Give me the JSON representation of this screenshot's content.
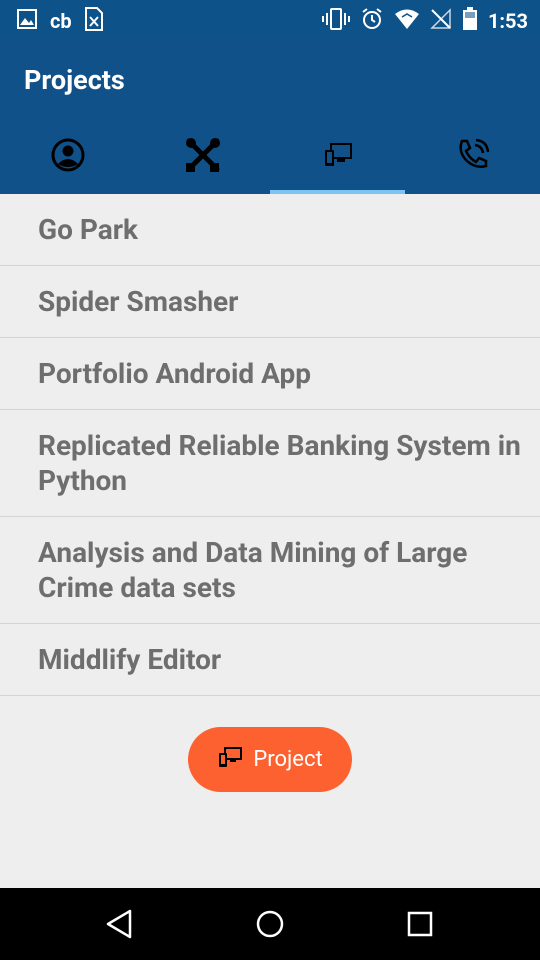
{
  "status_bar": {
    "carrier_label": "cb",
    "time": "1:53",
    "left_icons": [
      "gallery-icon",
      "cb-icon",
      "sim-card-icon"
    ],
    "right_icons": [
      "vibrate-icon",
      "alarm-icon",
      "wifi-icon",
      "no-signal-icon",
      "battery-icon"
    ]
  },
  "app_bar": {
    "title": "Projects",
    "tabs": [
      {
        "icon": "account-circle-icon",
        "active": false
      },
      {
        "icon": "tools-icon",
        "active": false
      },
      {
        "icon": "devices-icon",
        "active": true
      },
      {
        "icon": "phone-ringing-icon",
        "active": false
      }
    ]
  },
  "projects": [
    "Go Park",
    "Spider Smasher",
    "Portfolio Android App",
    "Replicated Reliable Banking System in Python",
    "Analysis and Data Mining of Large Crime data sets",
    "Middlify Editor"
  ],
  "fab": {
    "label": "Project",
    "icon": "devices-icon"
  },
  "colors": {
    "primary": "#115189",
    "status": "#0d5288",
    "accent": "#fe6130",
    "indicator": "#7cc4f2"
  },
  "nav_bar": {
    "buttons": [
      "back-icon",
      "home-icon",
      "recents-icon"
    ]
  }
}
